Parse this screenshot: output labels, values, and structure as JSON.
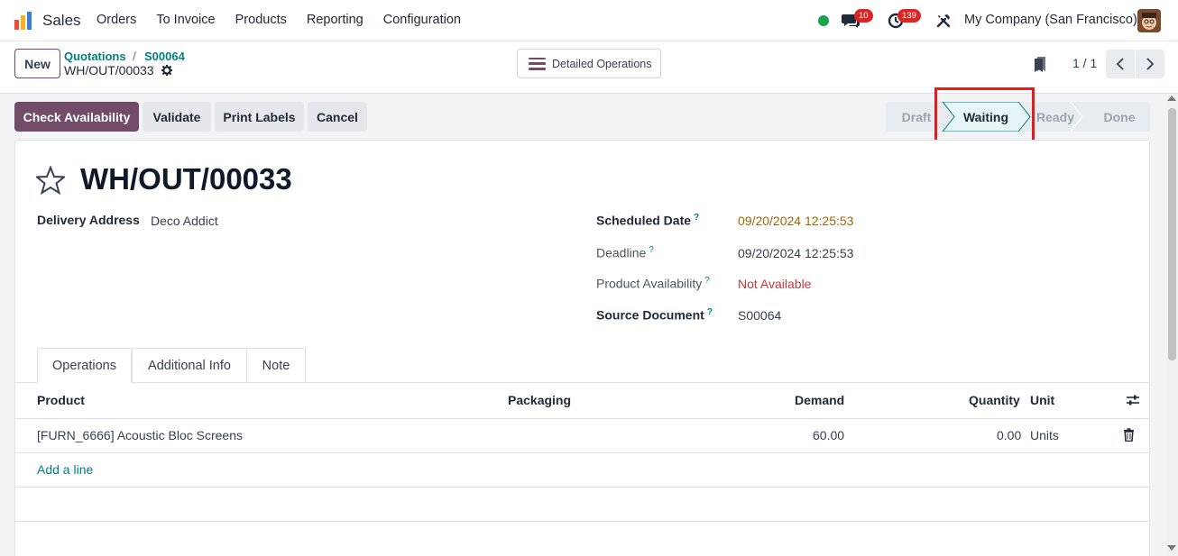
{
  "app": {
    "name": "Sales"
  },
  "menu": [
    "Orders",
    "To Invoice",
    "Products",
    "Reporting",
    "Configuration"
  ],
  "systray": {
    "chat_count": "10",
    "activity_count": "139",
    "company": "My Company (San Francisco)"
  },
  "control": {
    "new_label": "New",
    "breadcrumb": {
      "parent": "Quotations",
      "sep": "/",
      "order": "S00064",
      "current": "WH/OUT/00033"
    },
    "detailed_label": "Detailed Operations",
    "pager": "1 / 1"
  },
  "actions": {
    "check": "Check Availability",
    "validate": "Validate",
    "print": "Print Labels",
    "cancel": "Cancel"
  },
  "stages": {
    "draft": "Draft",
    "waiting": "Waiting",
    "ready": "Ready",
    "done": "Done",
    "current": "Waiting"
  },
  "record": {
    "title": "WH/OUT/00033",
    "delivery_address_label": "Delivery Address",
    "delivery_address": "Deco Addict",
    "scheduled_label": "Scheduled Date",
    "scheduled": "09/20/2024 12:25:53",
    "deadline_label": "Deadline",
    "deadline": "09/20/2024 12:25:53",
    "availability_label": "Product Availability",
    "availability": "Not Available",
    "source_label": "Source Document",
    "source": "S00064",
    "help": "?"
  },
  "tabs": [
    "Operations",
    "Additional Info",
    "Note"
  ],
  "table": {
    "headers": {
      "product": "Product",
      "packaging": "Packaging",
      "demand": "Demand",
      "quantity": "Quantity",
      "unit": "Unit"
    },
    "rows": [
      {
        "product": "[FURN_6666] Acoustic Bloc Screens",
        "demand": "60.00",
        "quantity": "0.00",
        "unit": "Units"
      }
    ],
    "add_line": "Add a line"
  },
  "colors": {
    "primary": "#714b67",
    "link": "#017e84",
    "warning": "#a0660a",
    "danger": "#c43b3b",
    "highlight": "#e11d1d"
  }
}
